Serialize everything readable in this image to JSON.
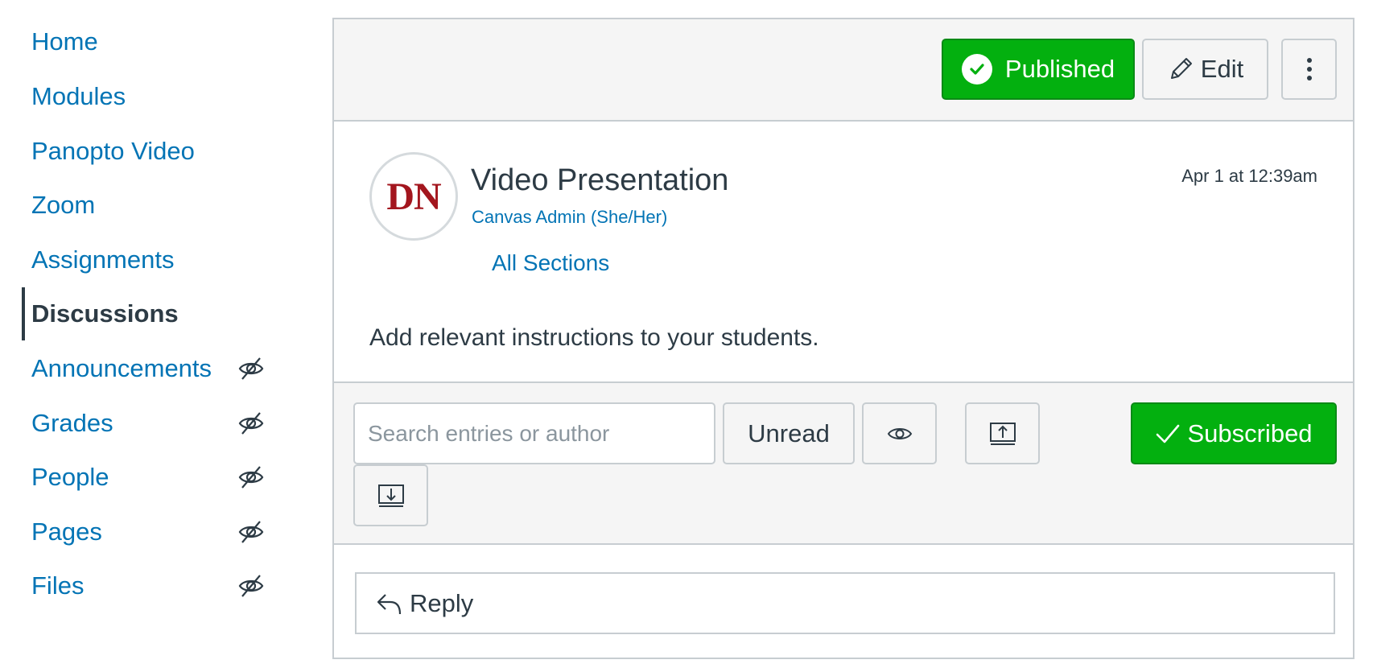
{
  "sidebar": {
    "items": [
      {
        "label": "Home",
        "active": false,
        "hidden": false
      },
      {
        "label": "Modules",
        "active": false,
        "hidden": false
      },
      {
        "label": "Panopto Video",
        "active": false,
        "hidden": false
      },
      {
        "label": "Zoom",
        "active": false,
        "hidden": false
      },
      {
        "label": "Assignments",
        "active": false,
        "hidden": false
      },
      {
        "label": "Discussions",
        "active": true,
        "hidden": false
      },
      {
        "label": "Announcements",
        "active": false,
        "hidden": true
      },
      {
        "label": "Grades",
        "active": false,
        "hidden": true
      },
      {
        "label": "People",
        "active": false,
        "hidden": true
      },
      {
        "label": "Pages",
        "active": false,
        "hidden": true
      },
      {
        "label": "Files",
        "active": false,
        "hidden": true
      }
    ],
    "hidden_icon": "eye-slash-icon"
  },
  "topbar": {
    "published_label": "Published",
    "edit_label": "Edit"
  },
  "post": {
    "avatar_initials": "DN",
    "title": "Video Presentation",
    "author": "Canvas Admin (She/Her)",
    "sections": "All Sections",
    "date": "Apr 1 at 12:39am",
    "body": "Add relevant instructions to your students."
  },
  "toolbar": {
    "search_placeholder": "Search entries or author",
    "unread_label": "Unread",
    "subscribed_label": "Subscribed"
  },
  "reply": {
    "label": "Reply"
  },
  "colors": {
    "link": "#0374b5",
    "text": "#2d3b45",
    "success": "#03b00f",
    "avatar_text": "#a3161e",
    "panel_bg": "#f5f5f5",
    "border": "#c7cdd1"
  }
}
